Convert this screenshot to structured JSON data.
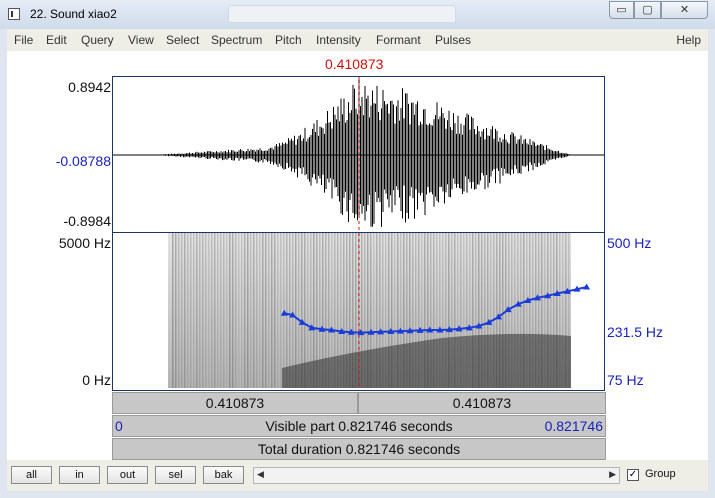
{
  "window": {
    "title": "22. Sound xiao2",
    "min_label": "▭",
    "max_label": "▢",
    "close_label": "✕"
  },
  "menu": {
    "items": [
      "File",
      "Edit",
      "Query",
      "View",
      "Select",
      "Spectrum",
      "Pitch",
      "Intensity",
      "Formant",
      "Pulses"
    ],
    "help": "Help"
  },
  "cursor": {
    "time_label": "0.410873",
    "time": 0.410873,
    "total": 0.821746
  },
  "waveform": {
    "max_label": "0.8942",
    "center_label": "-0.08788",
    "min_label": "-0.8984"
  },
  "spectrogram": {
    "left_top": "5000 Hz",
    "left_bottom": "0 Hz",
    "right_top": "500 Hz",
    "right_mid": "231.5 Hz",
    "right_bottom": "75 Hz"
  },
  "bars": {
    "left_time": "0.410873",
    "right_time": "0.410873",
    "visible_start": "0",
    "visible_text": "Visible part 0.821746 seconds",
    "visible_end": "0.821746",
    "total_text": "Total duration 0.821746 seconds"
  },
  "buttons": {
    "all": "all",
    "in": "in",
    "out": "out",
    "sel": "sel",
    "bak": "bak",
    "group_label": "Group",
    "group_checked": "✓"
  },
  "chart_data": {
    "type": "line",
    "title": "",
    "xlabel": "",
    "ylabel": "",
    "x_unit": "s",
    "y_unit": "Hz",
    "xlim": [
      0,
      0.821746
    ],
    "ylim": [
      75,
      500
    ],
    "series": [
      {
        "x": [
          0.286,
          0.3,
          0.316,
          0.332,
          0.349,
          0.365,
          0.382,
          0.398,
          0.414,
          0.431,
          0.447,
          0.464,
          0.48,
          0.496,
          0.513,
          0.529,
          0.546,
          0.562,
          0.578,
          0.595,
          0.611,
          0.628,
          0.644,
          0.66,
          0.677,
          0.693,
          0.709,
          0.726,
          0.742,
          0.759,
          0.775,
          0.791
        ],
        "y": [
          280,
          275,
          255,
          240,
          236,
          234,
          230,
          228,
          227,
          228,
          229,
          230,
          231,
          232,
          233,
          234,
          234,
          235,
          237,
          240,
          245,
          255,
          270,
          290,
          305,
          315,
          322,
          328,
          334,
          340,
          346,
          352
        ]
      }
    ]
  }
}
